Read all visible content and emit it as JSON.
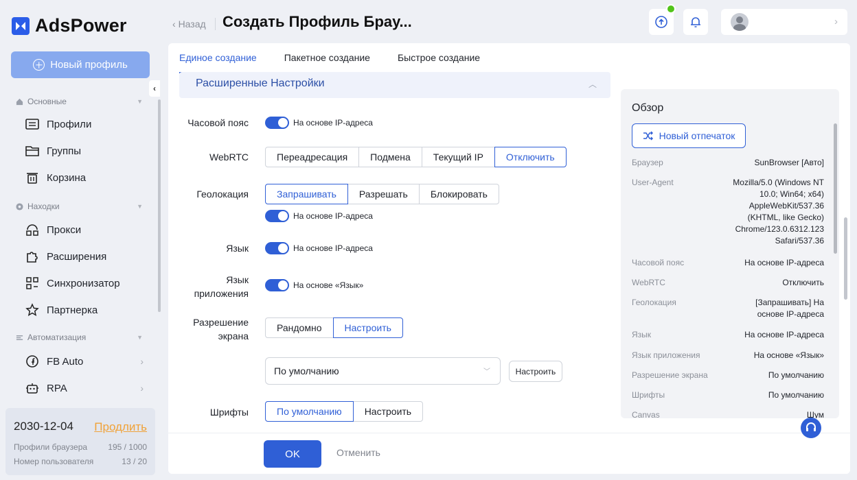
{
  "brand": {
    "name": "AdsPower"
  },
  "sidebar": {
    "new_profile_label": "Новый профиль",
    "collapse_glyph": "‹",
    "sections": [
      {
        "label": "Основные",
        "items": [
          {
            "label": "Профили"
          },
          {
            "label": "Группы"
          },
          {
            "label": "Корзина"
          }
        ]
      },
      {
        "label": "Находки",
        "items": [
          {
            "label": "Прокси"
          },
          {
            "label": "Расширения"
          },
          {
            "label": "Синхронизатор"
          },
          {
            "label": "Партнерка"
          }
        ]
      },
      {
        "label": "Автоматизация",
        "items": [
          {
            "label": "FB Auto"
          },
          {
            "label": "RPA"
          }
        ]
      }
    ],
    "footer": {
      "date": "2030-12-04",
      "renew_label": "Продлить",
      "browser_profiles_label": "Профили браузера",
      "browser_profiles_value": "195 / 1000",
      "user_number_label": "Номер пользователя",
      "user_number_value": "13 / 20"
    }
  },
  "header": {
    "back_label": "Назад",
    "title": "Создать Профиль Брау..."
  },
  "tabs": [
    {
      "label": "Единое создание",
      "active": true
    },
    {
      "label": "Пакетное создание",
      "active": false
    },
    {
      "label": "Быстрое создание",
      "active": false
    }
  ],
  "advanced": {
    "title": "Расширенные Настройки",
    "timezone": {
      "label": "Часовой пояс",
      "toggle_text": "На основе IP-адреса"
    },
    "webrtc": {
      "label": "WebRTC",
      "options": [
        "Переадресация",
        "Подмена",
        "Текущий IP",
        "Отключить"
      ],
      "selected": "Отключить"
    },
    "geolocation": {
      "label": "Геолокация",
      "options": [
        "Запрашивать",
        "Разрешать",
        "Блокировать"
      ],
      "selected": "Запрашивать",
      "toggle_text": "На основе IP-адреса"
    },
    "language": {
      "label": "Язык",
      "toggle_text": "На основе IP-адреса"
    },
    "app_language": {
      "label_line1": "Язык",
      "label_line2": "приложения",
      "toggle_text": "На основе «Язык»"
    },
    "resolution": {
      "label_line1": "Разрешение",
      "label_line2": "экрана",
      "options": [
        "Рандомно",
        "Настроить"
      ],
      "selected": "Настроить",
      "select_value": "По умолчанию",
      "custom_button": "Настроить"
    },
    "fonts": {
      "label": "Шрифты",
      "options": [
        "По умолчанию",
        "Настроить"
      ],
      "selected": "По умолчанию"
    }
  },
  "overview": {
    "title": "Обзор",
    "fingerprint_button": "Новый отпечаток",
    "rows": [
      {
        "key": "Браузер",
        "value": "SunBrowser [Авто]"
      },
      {
        "key": "User-Agent",
        "value_lines": [
          "Mozilla/5.0 (Windows NT",
          "10.0; Win64; x64)",
          "AppleWebKit/537.36",
          "(KHTML, like Gecko)",
          "Chrome/123.0.6312.123",
          "Safari/537.36"
        ]
      },
      {
        "key": "Часовой пояс",
        "value": "На основе IP-адреса"
      },
      {
        "key": "WebRTC",
        "value": "Отключить"
      },
      {
        "key": "Геолокация",
        "value_lines": [
          "[Запрашивать] На",
          "основе IP-адреса"
        ]
      },
      {
        "key": "Язык",
        "value": "На основе IP-адреса"
      },
      {
        "key": "Язык приложения",
        "value": "На основе «Язык»"
      },
      {
        "key": "Разрешение экрана",
        "value": "По умолчанию"
      },
      {
        "key": "Шрифты",
        "value": "По умолчанию"
      },
      {
        "key": "Canvas",
        "value": "Шум"
      }
    ]
  },
  "footer_actions": {
    "ok_label": "OK",
    "cancel_label": "Отменить"
  },
  "colors": {
    "accent": "#2f5fd6",
    "renew": "#f0a238",
    "notification_badge": "#52c41a"
  }
}
